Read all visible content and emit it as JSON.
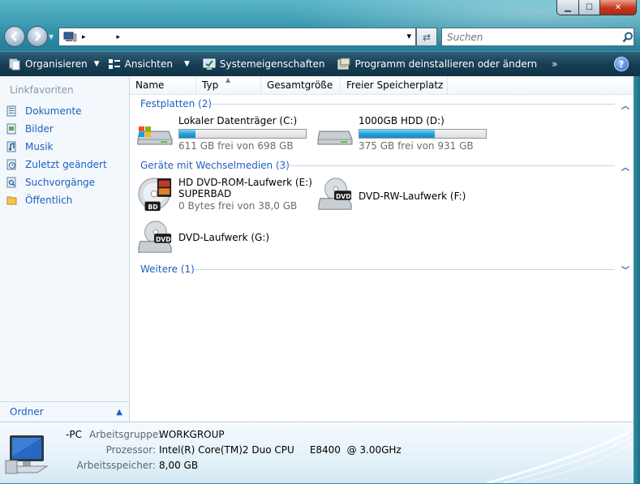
{
  "window": {
    "controls": {
      "minimize": "▁",
      "maximize": "☐",
      "close": "✕"
    }
  },
  "nav": {
    "back_icon": "back-arrow-icon",
    "forward_icon": "forward-arrow-icon",
    "address_sep1": "▸",
    "address_sep2": "▸",
    "address_dropdown": "▾",
    "refresh": "⇄",
    "search_placeholder": "Suchen"
  },
  "toolbar": {
    "organize": "Organisieren",
    "views": "Ansichten",
    "system_properties": "Systemeigenschaften",
    "uninstall": "Programm deinstallieren oder ändern",
    "more": "»",
    "help": "?"
  },
  "sidebar": {
    "title": "Linkfavoriten",
    "items": [
      {
        "label": "Dokumente",
        "icon": "documents-icon"
      },
      {
        "label": "Bilder",
        "icon": "pictures-icon"
      },
      {
        "label": "Musik",
        "icon": "music-icon"
      },
      {
        "label": "Zuletzt geändert",
        "icon": "recent-icon"
      },
      {
        "label": "Suchvorgänge",
        "icon": "search-folder-icon"
      },
      {
        "label": "Öffentlich",
        "icon": "public-folder-icon"
      }
    ],
    "folders_label": "Ordner"
  },
  "columns": [
    "Name",
    "Typ",
    "Gesamtgröße",
    "Freier Speicherplatz"
  ],
  "groups": {
    "hard_disks": "Festplatten (2)",
    "removable": "Geräte mit Wechselmedien (3)",
    "other": "Weitere (1)"
  },
  "drives": {
    "c": {
      "name": "Lokaler Datenträger (C:)",
      "free": "611 GB frei von 698 GB",
      "used_fraction": 0.125
    },
    "d": {
      "name": "1000GB HDD (D:)",
      "free": "375 GB frei von 931 GB",
      "used_fraction": 0.597
    },
    "e": {
      "name": "HD DVD-ROM-Laufwerk (E:)",
      "label": "SUPERBAD",
      "free": "0 Bytes frei von 38,0 GB",
      "badge": "BD"
    },
    "f": {
      "name": "DVD-RW-Laufwerk (F:)",
      "badge": "DVD"
    },
    "g": {
      "name": "DVD-Laufwerk (G:)",
      "badge": "DVD"
    }
  },
  "details": {
    "pc_name": "-PC",
    "workgroup_label": "Arbeitsgruppe:",
    "workgroup": "WORKGROUP",
    "processor_label": "Prozessor:",
    "processor": "Intel(R) Core(TM)2 Duo CPU     E8400  @ 3.00GHz",
    "memory_label": "Arbeitsspeicher:",
    "memory": "8,00 GB"
  },
  "colors": {
    "link": "#1f5fbf",
    "toolbar": "#183f55",
    "bar": "#26a0da"
  }
}
